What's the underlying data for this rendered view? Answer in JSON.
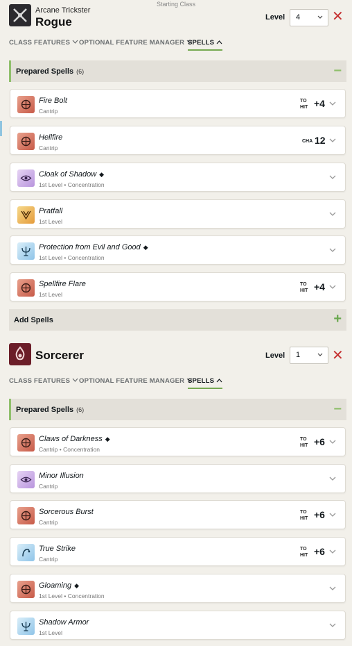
{
  "header": {
    "starting_class": "Starting Class"
  },
  "classes": [
    {
      "subclass": "Arcane Trickster",
      "name": "Rogue",
      "level_label": "Level",
      "level_value": "4",
      "tabs": [
        "CLASS FEATURES",
        "OPTIONAL FEATURE MANAGER",
        "SPELLS"
      ],
      "prepared_title": "Prepared Spells",
      "prepared_count": "(6)",
      "spells": [
        {
          "name": "Fire Bolt",
          "sub": "Cantrip",
          "label": "TO HIT",
          "value": "+4",
          "icon": "red"
        },
        {
          "name": "Hellfire",
          "sub": "Cantrip",
          "label": "CHA",
          "value": "12",
          "icon": "red"
        },
        {
          "name": "Cloak of Shadow",
          "sub": "1st Level • Concentration",
          "icon": "purple"
        },
        {
          "name": "Pratfall",
          "sub": "1st Level",
          "icon": "gold"
        },
        {
          "name": "Protection from Evil and Good",
          "sub": "1st Level • Concentration",
          "icon": "blue"
        },
        {
          "name": "Spellfire Flare",
          "sub": "1st Level",
          "label": "TO HIT",
          "value": "+4",
          "icon": "red"
        }
      ],
      "add_spells": "Add Spells"
    },
    {
      "subclass": "",
      "name": "Sorcerer",
      "level_label": "Level",
      "level_value": "1",
      "tabs": [
        "CLASS FEATURES",
        "OPTIONAL FEATURE MANAGER",
        "SPELLS"
      ],
      "prepared_title": "Prepared Spells",
      "prepared_count": "(6)",
      "spells": [
        {
          "name": "Claws of Darkness",
          "sub": "Cantrip • Concentration",
          "label": "TO HIT",
          "value": "+6",
          "icon": "red"
        },
        {
          "name": "Minor Illusion",
          "sub": "Cantrip",
          "icon": "purple"
        },
        {
          "name": "Sorcerous Burst",
          "sub": "Cantrip",
          "label": "TO HIT",
          "value": "+6",
          "icon": "red"
        },
        {
          "name": "True Strike",
          "sub": "Cantrip",
          "label": "TO HIT",
          "value": "+6",
          "icon": "blue"
        },
        {
          "name": "Gloaming",
          "sub": "1st Level • Concentration",
          "icon": "red"
        },
        {
          "name": "Shadow Armor",
          "sub": "1st Level",
          "icon": "blue"
        }
      ]
    }
  ],
  "colors": {
    "accent_green": "#8fbf6b",
    "close_red": "#c53131"
  }
}
